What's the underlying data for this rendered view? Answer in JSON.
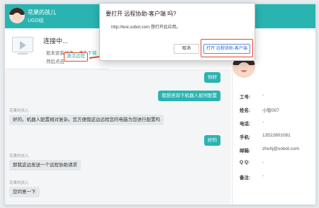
{
  "header": {
    "user_name": "花果的孩儿",
    "group": "UGD组"
  },
  "connect_panel": {
    "title": "连接中...",
    "line1_prefix": "· 如未安装插件，请先",
    "line1_link": "下载",
    "line2_prefix": "· 然后点击",
    "activate_button": "激活远程"
  },
  "dialog": {
    "title": "要打开 远程协助-客户端 吗?",
    "message": "http://test.sobot.com 想打开此应用。",
    "cancel_label": "取消",
    "open_label": "打开 远程协助-客户端"
  },
  "chat": {
    "messages": [
      {
        "side": "out",
        "text": "你好"
      },
      {
        "side": "out",
        "text": "我想咨询下机器人如何配置"
      },
      {
        "side": "in",
        "sender": "花果的孩儿",
        "text": "好的。机器人配置相对复杂。您方便我这边远程您的电脑为您进行配置吗"
      },
      {
        "side": "out",
        "text": "好的"
      },
      {
        "side": "in",
        "sender": "花果的孩儿",
        "text": "那我这边发送一个远程协助请求"
      },
      {
        "side": "in",
        "sender": "花果的孩儿",
        "text": "您同意一下"
      }
    ]
  },
  "customer_info": {
    "fields": [
      {
        "label": "工号:",
        "value": "-"
      },
      {
        "label": "姓名:",
        "value": "小智007"
      },
      {
        "label": "电话:",
        "value": "-"
      },
      {
        "label": "手机:",
        "value": "13522801081"
      },
      {
        "label": "邮箱:",
        "value": "zhuhj@sobot.com"
      },
      {
        "label": "Q Q:",
        "value": "-"
      },
      {
        "label": "备注:",
        "value": "-"
      }
    ]
  },
  "colors": {
    "brand": "#2ab4b1",
    "highlight": "#e8462a"
  }
}
